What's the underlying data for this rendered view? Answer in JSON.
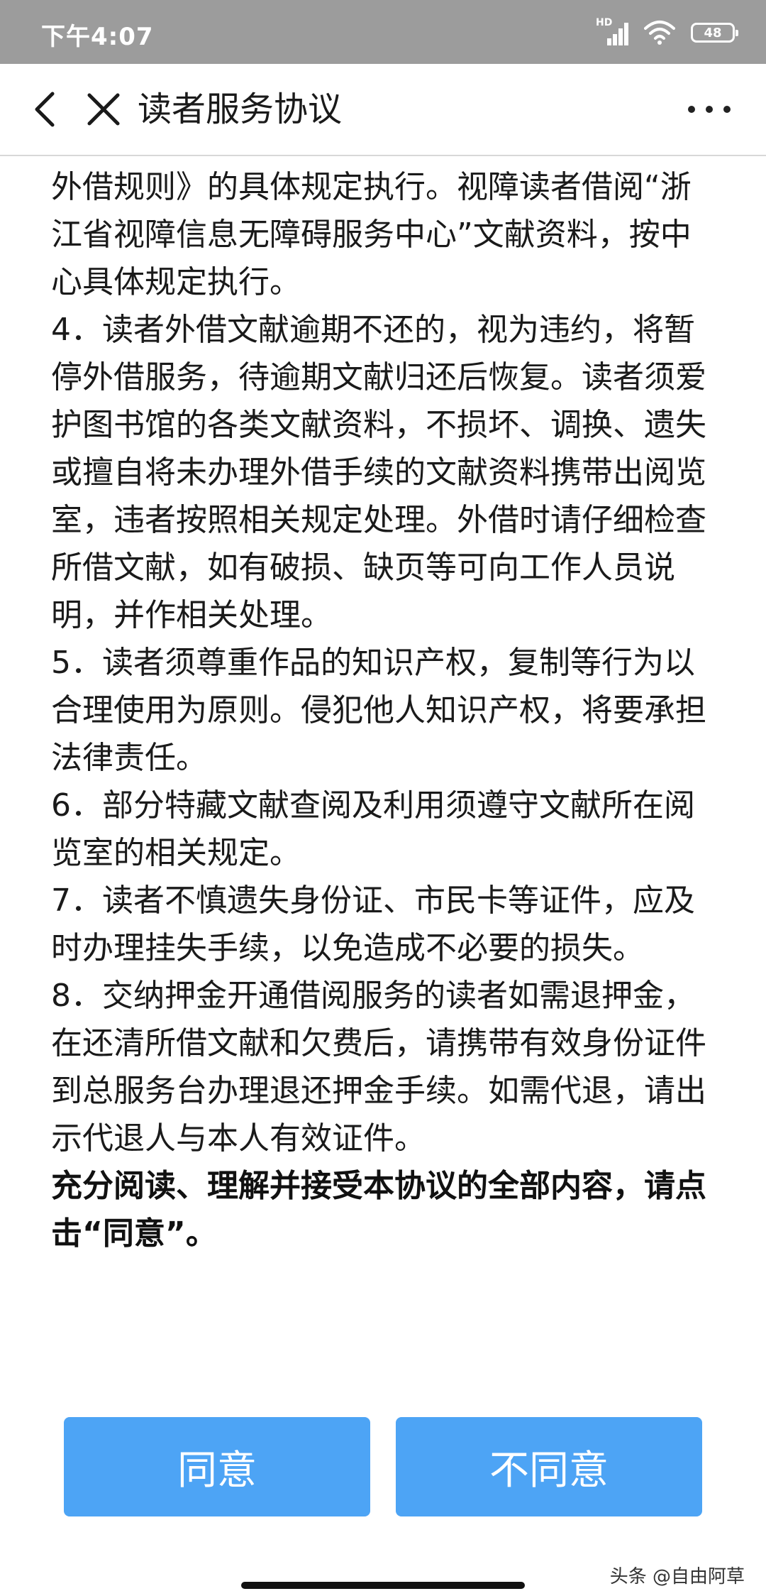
{
  "status_bar": {
    "time": "下午4:07",
    "network_label": "HD",
    "battery": "48"
  },
  "header": {
    "title": "读者服务协议"
  },
  "content": {
    "paragraphs": [
      "外借规则》的具体规定执行。视障读者借阅“浙江省视障信息无障碍服务中心”文献资料，按中心具体规定执行。",
      "4．读者外借文献逾期不还的，视为违约，将暂停外借服务，待逾期文献归还后恢复。读者须爱护图书馆的各类文献资料，不损坏、调换、遗失或擅自将未办理外借手续的文献资料携带出阅览室，违者按照相关规定处理。外借时请仔细检查所借文献，如有破损、缺页等可向工作人员说明，并作相关处理。",
      "5．读者须尊重作品的知识产权，复制等行为以合理使用为原则。侵犯他人知识产权，将要承担法律责任。",
      "6．部分特藏文献查阅及利用须遵守文献所在阅览室的相关规定。",
      "7．读者不慎遗失身份证、市民卡等证件，应及时办理挂失手续，以免造成不必要的损失。",
      "8．交纳押金开通借阅服务的读者如需退押金，在还清所借文献和欠费后，请携带有效身份证件到总服务台办理退还押金手续。如需代退，请出示代退人与本人有效证件。"
    ],
    "confirm_notice": "充分阅读、理解并接受本协议的全部内容，请点击“同意”。"
  },
  "buttons": {
    "agree": "同意",
    "disagree": "不同意"
  },
  "watermark": "头条 @自由阿草",
  "colors": {
    "status_bar_bg": "#9c9c9c",
    "button_bg": "#4da4f5",
    "text": "#1a1a1a"
  }
}
